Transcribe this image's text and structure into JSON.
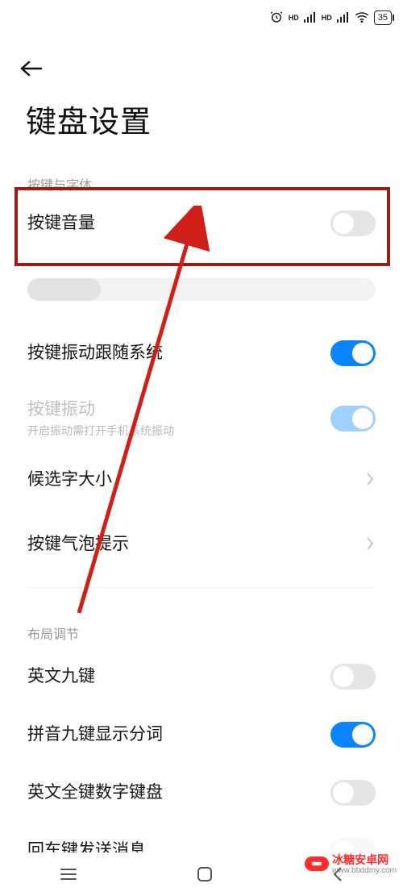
{
  "status_bar": {
    "alarm_icon": "alarm",
    "hd1": "HD",
    "signal1": "antenna",
    "hd2": "HD",
    "signal2": "antenna",
    "wifi": "wifi",
    "battery_text": "35"
  },
  "header": {
    "back": "back"
  },
  "title": "键盘设置",
  "section_keys": "按键与字体",
  "section_layout": "布局调节",
  "rows": {
    "key_volume": {
      "label": "按键音量",
      "toggle": false
    },
    "vibrate_follow": {
      "label": "按键振动跟随系统",
      "toggle": true
    },
    "key_vibrate": {
      "label": "按键振动",
      "sub": "开启振动需打开手机系统振动",
      "toggle": true,
      "disabled": true
    },
    "candidate_size": {
      "label": "候选字大小"
    },
    "key_bubble": {
      "label": "按键气泡提示"
    },
    "eng_9key": {
      "label": "英文九键",
      "toggle": false
    },
    "pinyin_9key_segment": {
      "label": "拼音九键显示分词",
      "toggle": true
    },
    "eng_full_numrow": {
      "label": "英文全键数字键盘",
      "toggle": false
    },
    "enter_send": {
      "label": "回车键发送消息"
    }
  },
  "slider": {
    "value_percent": 21
  },
  "watermark": {
    "brand": "冰糖安卓网",
    "url": "www.btxtdmy.com"
  }
}
